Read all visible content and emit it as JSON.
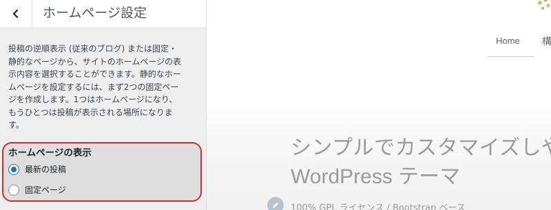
{
  "panel": {
    "title": "ホームページ設定",
    "description_lines": [
      "投稿の逆順表示 (従来のブログ) または固定・",
      "静的なページから、サイトのホームページの表",
      "示内容を選択することができます。静的なホー",
      "ムページを設定するには、まず2つの固定ペー",
      "ジを作成します。1つはホームページになり、",
      "もうひとつは投稿が表示される場所になりま",
      "す。"
    ],
    "homepage_display": {
      "title": "ホームページの表示",
      "options": [
        {
          "label": "最新の投稿",
          "checked": true
        },
        {
          "label": "固定ページ",
          "checked": false
        }
      ]
    }
  },
  "preview": {
    "nav": {
      "home": "Home",
      "next_partial": "構"
    },
    "hero": {
      "line1": "シンプルでカスタマイズしや",
      "line2": "WordPress テーマ"
    },
    "meta_text": "100% GPL ライセンス / Bootstrap ベース"
  },
  "colors": {
    "highlight_border": "#d92a2a",
    "radio_accent": "#2271b1"
  }
}
